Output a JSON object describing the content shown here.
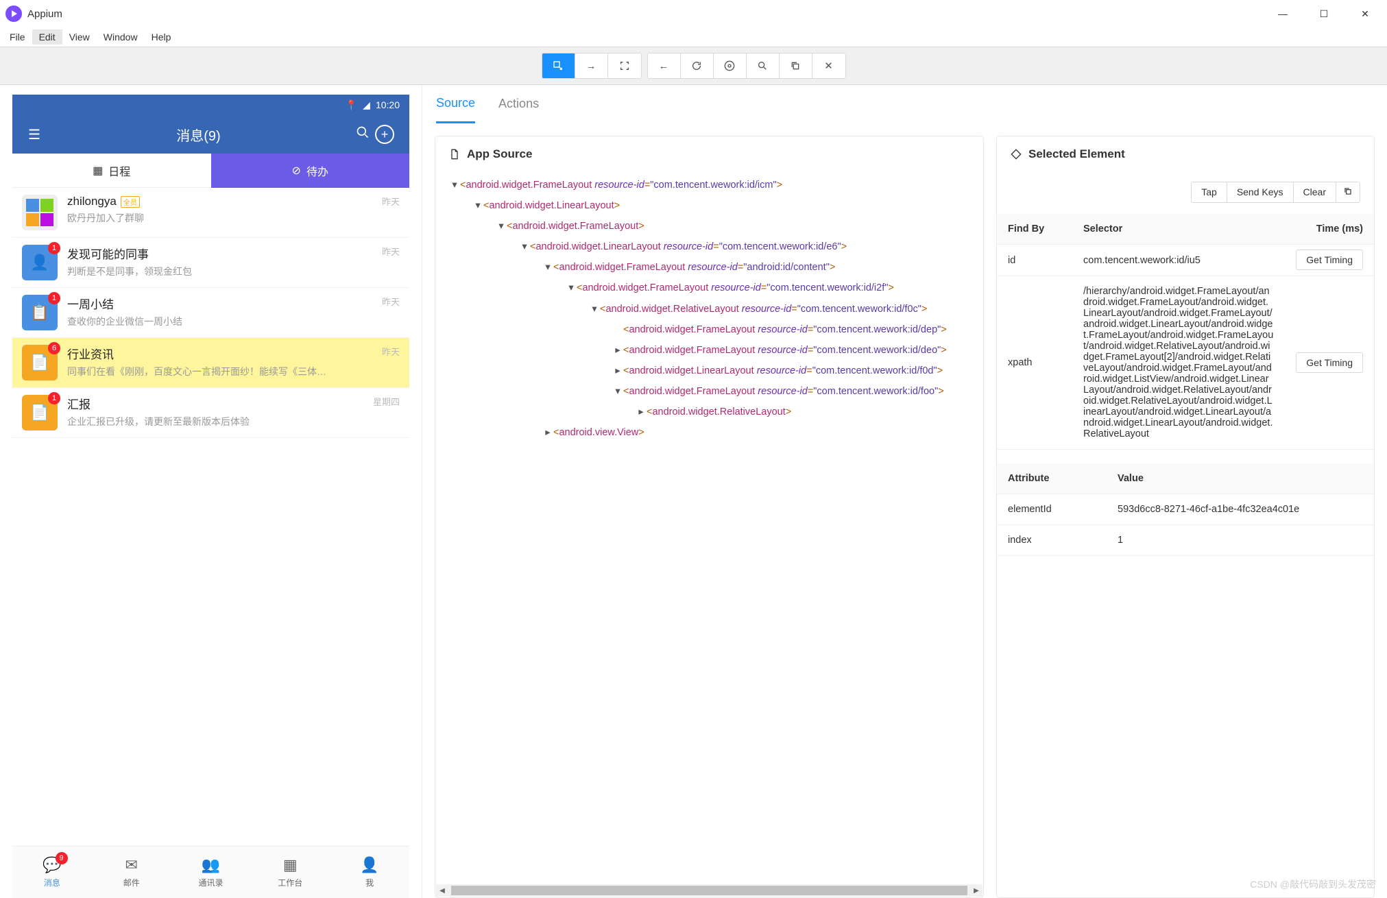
{
  "window": {
    "title": "Appium"
  },
  "menubar": [
    "File",
    "Edit",
    "View",
    "Window",
    "Help"
  ],
  "tabs": {
    "source": "Source",
    "actions": "Actions"
  },
  "source_panel": {
    "title": "App Source"
  },
  "selected_panel": {
    "title": "Selected Element"
  },
  "actions": {
    "tap": "Tap",
    "send_keys": "Send Keys",
    "clear": "Clear"
  },
  "findby_header": {
    "findby": "Find By",
    "selector": "Selector",
    "time": "Time (ms)"
  },
  "findby_rows": [
    {
      "key": "id",
      "selector": "com.tencent.wework:id/iu5",
      "btn": "Get Timing"
    },
    {
      "key": "xpath",
      "selector": "/hierarchy/android.widget.FrameLayout/android.widget.FrameLayout/android.widget.LinearLayout/android.widget.FrameLayout/android.widget.LinearLayout/android.widget.FrameLayout/android.widget.FrameLayout/android.widget.RelativeLayout/android.widget.FrameLayout[2]/android.widget.RelativeLayout/android.widget.FrameLayout/android.widget.ListView/android.widget.LinearLayout/android.widget.RelativeLayout/android.widget.RelativeLayout/android.widget.LinearLayout/android.widget.LinearLayout/android.widget.LinearLayout/android.widget.RelativeLayout",
      "btn": "Get Timing"
    }
  ],
  "attr_header": {
    "attribute": "Attribute",
    "value": "Value"
  },
  "attr_rows": [
    {
      "k": "elementId",
      "v": "593d6cc8-8271-46cf-a1be-4fc32ea4c01e"
    },
    {
      "k": "index",
      "v": "1"
    }
  ],
  "tree": [
    {
      "indent": 0,
      "arrow": "▾",
      "tag": "android.widget.FrameLayout",
      "attr": "resource-id",
      "val": "com.tencent.wework:id/icm"
    },
    {
      "indent": 1,
      "arrow": "▾",
      "tag": "android.widget.LinearLayout"
    },
    {
      "indent": 2,
      "arrow": "▾",
      "tag": "android.widget.FrameLayout"
    },
    {
      "indent": 3,
      "arrow": "▾",
      "tag": "android.widget.LinearLayout",
      "attr": "resource-id",
      "val": "com.tencent.wework:id/e6"
    },
    {
      "indent": 4,
      "arrow": "▾",
      "tag": "android.widget.FrameLayout",
      "attr": "resource-id",
      "val": "android:id/content"
    },
    {
      "indent": 5,
      "arrow": "▾",
      "tag": "android.widget.FrameLayout",
      "attr": "resource-id",
      "val": "com.tencent.wework:id/i2f"
    },
    {
      "indent": 6,
      "arrow": "▾",
      "tag": "android.widget.RelativeLayout",
      "attr": "resource-id",
      "val": "com.tencent.wework:id/f0c"
    },
    {
      "indent": 7,
      "arrow": "",
      "tag": "android.widget.FrameLayout",
      "attr": "resource-id",
      "val": "com.tencent.wework:id/dep"
    },
    {
      "indent": 7,
      "arrow": "▸",
      "tag": "android.widget.FrameLayout",
      "attr": "resource-id",
      "val": "com.tencent.wework:id/deo"
    },
    {
      "indent": 7,
      "arrow": "▸",
      "tag": "android.widget.LinearLayout",
      "attr": "resource-id",
      "val": "com.tencent.wework:id/f0d"
    },
    {
      "indent": 7,
      "arrow": "▾",
      "tag": "android.widget.FrameLayout",
      "attr": "resource-id",
      "val": "com.tencent.wework:id/foo"
    },
    {
      "indent": 8,
      "arrow": "▸",
      "tag": "android.widget.RelativeLayout"
    },
    {
      "indent": 4,
      "arrow": "▸",
      "tag": "android.view.View"
    }
  ],
  "device": {
    "status_time": "10:20",
    "header_title": "消息(9)",
    "subtabs": {
      "schedule": "日程",
      "todo": "待办"
    },
    "chats": [
      {
        "avatar": "grid",
        "badge": "",
        "title": "zhilongya",
        "tag": "全员",
        "subtitle": "欧丹丹加入了群聊",
        "time": "昨天",
        "highlight": false
      },
      {
        "avatar": "blue",
        "badge": "1",
        "title": "发现可能的同事",
        "subtitle": "判断是不是同事，领现金红包",
        "time": "昨天",
        "highlight": false,
        "icon": "👤"
      },
      {
        "avatar": "blue",
        "badge": "1",
        "title": "一周小结",
        "subtitle": "查收你的企业微信一周小结",
        "time": "昨天",
        "highlight": false,
        "icon": "📋"
      },
      {
        "avatar": "orange",
        "badge": "6",
        "title": "行业资讯",
        "subtitle": "同事们在看《刚刚，百度文心一言揭开面纱！能续写《三体…",
        "time": "昨天",
        "highlight": true,
        "icon": "📄"
      },
      {
        "avatar": "orange",
        "badge": "1",
        "title": "汇报",
        "subtitle": "企业汇报已升级，请更新至最新版本后体验",
        "time": "星期四",
        "highlight": false,
        "icon": "📄"
      }
    ],
    "bottom_nav": [
      {
        "label": "消息",
        "badge": "9",
        "active": true
      },
      {
        "label": "邮件"
      },
      {
        "label": "通讯录"
      },
      {
        "label": "工作台"
      },
      {
        "label": "我"
      }
    ]
  },
  "watermark": "CSDN @敲代码敲到头发茂密"
}
